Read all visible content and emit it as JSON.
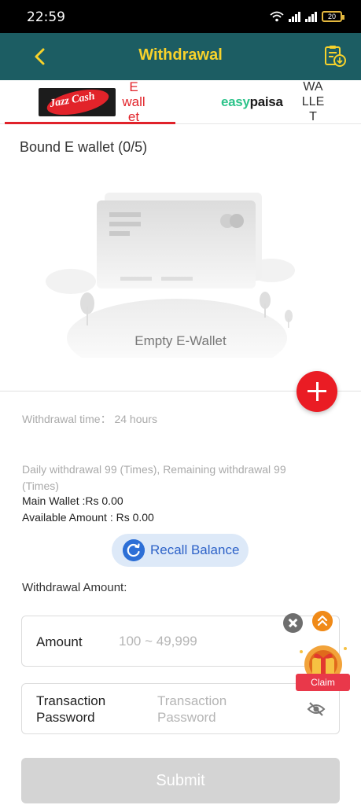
{
  "status_bar": {
    "time": "22:59",
    "battery": "20"
  },
  "header": {
    "title": "Withdrawal"
  },
  "tabs": [
    {
      "logo_text": "Jazz Cash",
      "label": "E wall et",
      "label_lines": [
        "E",
        "wall",
        "et"
      ],
      "active": true
    },
    {
      "logo_text_prefix": "easy",
      "logo_text_suffix": "paisa",
      "label": "WA LLE T",
      "label_lines": [
        "WA",
        "LLE",
        "T"
      ],
      "active": false
    }
  ],
  "bound": {
    "title": "Bound E wallet (0/5)",
    "empty_label": "Empty E-Wallet"
  },
  "info": {
    "withdrawal_time": "Withdrawal time：  24 hours",
    "daily_limit": "Daily withdrawal 99 (Times), Remaining withdrawal 99 (Times)",
    "main_wallet": "Main Wallet :Rs 0.00",
    "available_amount": "Available Amount : Rs 0.00"
  },
  "recall": {
    "label": "Recall Balance"
  },
  "form": {
    "section_label": "Withdrawal Amount:",
    "amount_label": "Amount",
    "amount_placeholder": "100 ~ 49,999",
    "password_label_lines": [
      "Transaction",
      "Password"
    ],
    "password_placeholder_lines": [
      "Transaction",
      "Password"
    ]
  },
  "claim": {
    "label": "Claim"
  },
  "submit": {
    "label": "Submit"
  },
  "colors": {
    "header_bg": "#1c5d63",
    "title_yellow": "#f7d22b",
    "accent_red": "#e0222a",
    "recall_blue": "#2d6fd6",
    "submit_disabled": "#d4d4d4"
  },
  "icons": {
    "back": "chevron-left-icon",
    "records": "clipboard-download-icon",
    "add": "plus-icon",
    "recall": "refresh-icon",
    "clear": "close-icon",
    "eye": "eye-off-icon",
    "scroll_top": "double-chevron-up-icon",
    "gift": "gift-icon"
  }
}
